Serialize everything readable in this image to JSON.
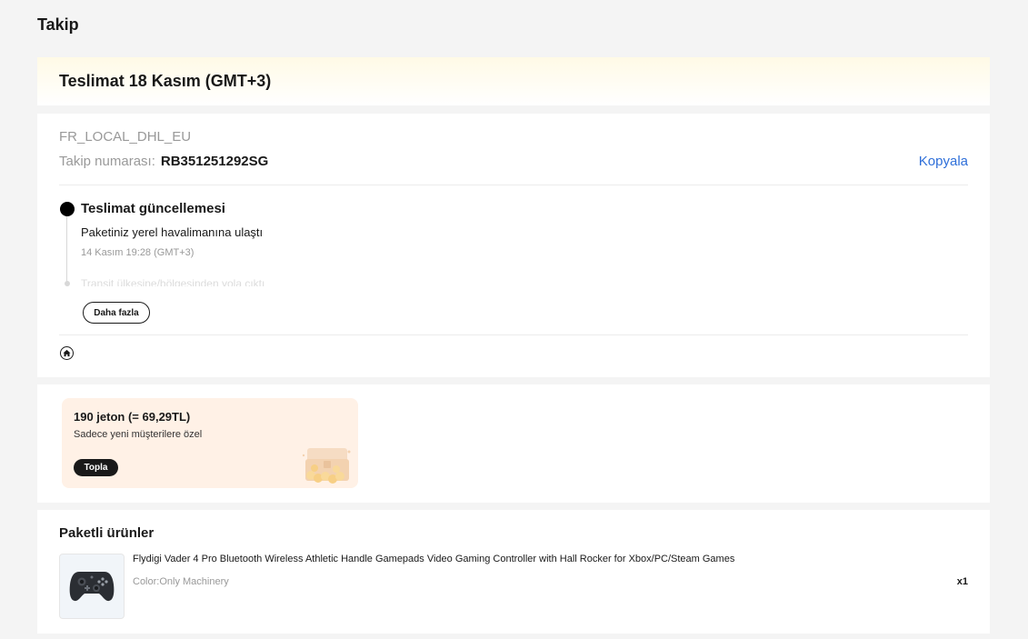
{
  "page": {
    "title": "Takip"
  },
  "delivery": {
    "title": "Teslimat 18 Kasım (GMT+3)"
  },
  "tracking": {
    "carrier": "FR_LOCAL_DHL_EU",
    "number_label": "Takip numarası:",
    "number": "RB351251292SG",
    "copy_label": "Kopyala",
    "latest_event": {
      "title": "Teslimat güncellemesi",
      "description": "Paketiniz yerel havalimanına ulaştı",
      "time": "14 Kasım 19:28 (GMT+3)"
    },
    "previous_event": "Transit ülkesine/bölgesinden yola çıktı",
    "more_label": "Daha fazla",
    "home_icon": "home-icon"
  },
  "coins": {
    "title": "190 jeton (= 69,29TL)",
    "subtitle": "Sadece yeni müşterilere özel",
    "collect_label": "Topla",
    "icon": "treasure-chest-icon"
  },
  "products": {
    "title": "Paketli ürünler",
    "items": [
      {
        "name": "Flydigi Vader 4 Pro Bluetooth Wireless Athletic Handle Gamepads Video Gaming Controller with Hall Rocker for Xbox/PC/Steam Games",
        "variant": "Color:Only Machinery",
        "quantity": "x1",
        "icon": "gamepad-icon"
      }
    ]
  },
  "colors": {
    "accent_link": "#2e6fd9",
    "coin_box_bg": "#fff1e6",
    "page_bg": "#f4f4f4"
  }
}
